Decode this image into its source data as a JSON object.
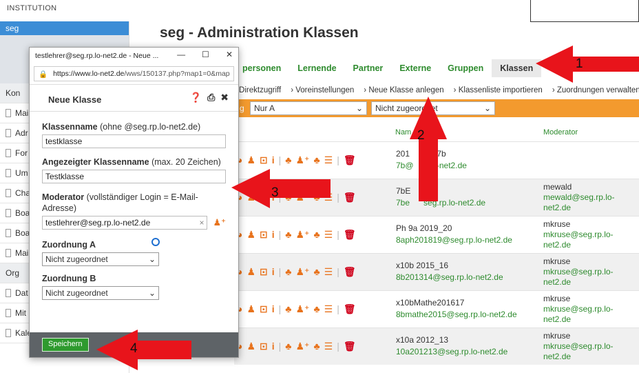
{
  "institution": "INSTITUTION",
  "sidebar": {
    "header": "seg",
    "items": [
      {
        "label": "Kon"
      },
      {
        "label": "Mai"
      },
      {
        "label": "Adr"
      },
      {
        "label": "For"
      },
      {
        "label": "Um"
      },
      {
        "label": "Cha"
      },
      {
        "label": "Boa"
      },
      {
        "label": "Boa"
      },
      {
        "label": "Mai"
      },
      {
        "label": "Org"
      },
      {
        "label": "Dat"
      },
      {
        "label": "Mit"
      },
      {
        "label": "Kalender"
      }
    ]
  },
  "page": {
    "title": "seg - Administration Klassen"
  },
  "tabs": [
    "personen",
    "Lernende",
    "Partner",
    "Externe",
    "Gruppen",
    "Klassen"
  ],
  "crumbs": [
    "Direktzugriff",
    "Voreinstellungen",
    "Neue Klasse anlegen",
    "Klassenliste importieren",
    "Zuordnungen verwalten"
  ],
  "filter": {
    "label": "g",
    "select1": "Nur A",
    "select2": "Nicht zugeordnet"
  },
  "columns": {
    "name": "Nam",
    "moderator": "Moderator"
  },
  "rows": [
    {
      "name": "201",
      "name_tail": "e_7b",
      "mail": "7b@",
      "mail_tail": "o.lo-net2.de",
      "mod_name": "",
      "mod_mail": ""
    },
    {
      "name": "7bE",
      "name_tail": "",
      "mail": "7be",
      "mail_tail": "seg.rp.lo-net2.de",
      "mod_name": "mewald",
      "mod_mail": "mewald@seg.rp.lo-net2.de"
    },
    {
      "name": "Ph 9a 2019_20",
      "name_tail": "",
      "mail": "8aph201819@seg.rp.lo-net2.de",
      "mail_tail": "",
      "mod_name": "mkruse",
      "mod_mail": "mkruse@seg.rp.lo-net2.de"
    },
    {
      "name": "x10b 2015_16",
      "name_tail": "",
      "mail": "8b201314@seg.rp.lo-net2.de",
      "mail_tail": "",
      "mod_name": "mkruse",
      "mod_mail": "mkruse@seg.rp.lo-net2.de"
    },
    {
      "name": "x10bMathe201617",
      "name_tail": "",
      "mail": "8bmathe2015@seg.rp.lo-net2.de",
      "mail_tail": "",
      "mod_name": "mkruse",
      "mod_mail": "mkruse@seg.rp.lo-net2.de"
    },
    {
      "name": "x10a 2012_13",
      "name_tail": "",
      "mail": "10a201213@seg.rp.lo-net2.de",
      "mail_tail": "",
      "mod_name": "mkruse",
      "mod_mail": "mkruse@seg.rp.lo-net2.de"
    }
  ],
  "popup": {
    "window_title": "testlehrer@seg.rp.lo-net2.de - Neue ...",
    "url_host": "https://www.lo-net2.de",
    "url_path": "/wws/150137.php?map1=0&map",
    "dialog_title": "Neue Klasse",
    "field_name_label": "Klassenname",
    "field_name_hint": "(ohne @seg.rp.lo-net2.de)",
    "field_name_value": "testklasse",
    "field_display_label": "Angezeigter Klassenname",
    "field_display_hint": "(max. 20 Zeichen)",
    "field_display_value": "Testklasse",
    "field_mod_label": "Moderator",
    "field_mod_hint": "(vollständiger Login = E-Mail-Adresse)",
    "field_mod_value": "testlehrer@seg.rp.lo-net2.de",
    "assign_a_label": "Zuordnung A",
    "assign_a_value": "Nicht zugeordnet",
    "assign_b_label": "Zuordnung B",
    "assign_b_value": "Nicht zugeordnet",
    "save_label": "Speichern"
  },
  "annotations": [
    "1",
    "2",
    "3",
    "4"
  ],
  "colors": {
    "arrow": "#e8141b",
    "green": "#2e8b2e",
    "orange": "#f39a2e",
    "sidebar_blue": "#3c8dd6"
  }
}
